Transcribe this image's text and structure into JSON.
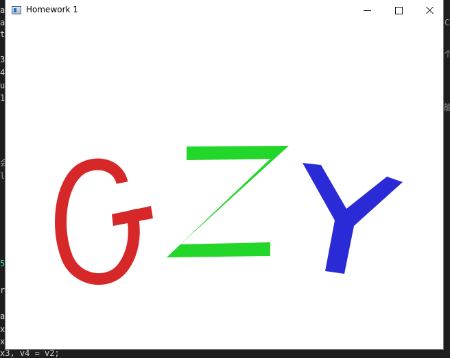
{
  "window": {
    "title": "Homework 1",
    "controls": {
      "minimize": "minimize",
      "maximize": "maximize",
      "close": "close"
    }
  },
  "canvas": {
    "letters": [
      {
        "char": "G",
        "color": "#d62828"
      },
      {
        "char": "Z",
        "color": "#22d62a"
      },
      {
        "char": "Y",
        "color": "#2a2ad6"
      }
    ]
  },
  "background": {
    "left_chars": [
      "a",
      "a",
      "t",
      "3",
      "4",
      "u",
      "1",
      "会",
      "lo",
      "5",
      "ri",
      "a",
      "x",
      "x"
    ],
    "bottom_line": "x3, v4 = v2;",
    "right_chars": [
      "C",
      "个",
      "能"
    ]
  }
}
